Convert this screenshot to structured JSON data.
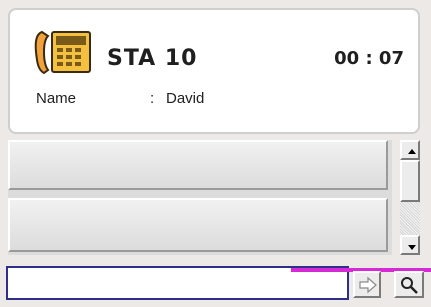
{
  "call_panel": {
    "station": "STA 10",
    "timer": "00 : 07",
    "name_label": "Name",
    "name_separator": ":",
    "name_value": "David",
    "icon": "phone-with-keypad-icon"
  },
  "line_list": {
    "slots": [
      "",
      ""
    ]
  },
  "input": {
    "value": "",
    "placeholder": ""
  },
  "buttons": {
    "transfer_icon": "arrow-right-icon",
    "search_icon": "search-icon"
  },
  "colors": {
    "accent_line": "#d62ad6",
    "input_border": "#2f2f8a",
    "phone_orange": "#f2a23a"
  }
}
